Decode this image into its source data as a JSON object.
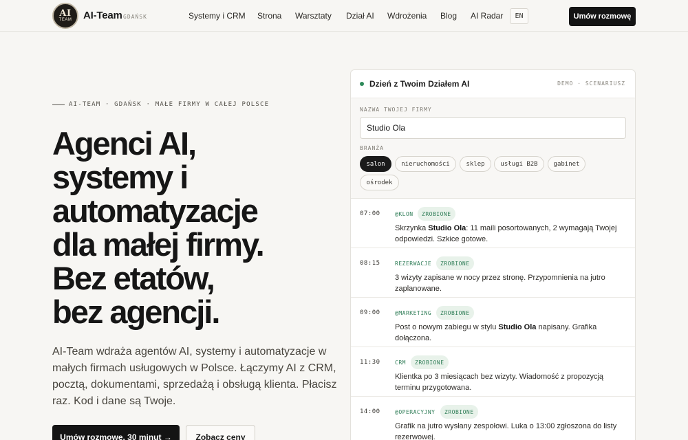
{
  "header": {
    "logo_line1": "AI",
    "logo_line2": "TEAM",
    "brand": "AI-Team",
    "brand_sub": "GDAŃSK",
    "nav": [
      {
        "label": "Systemy i CRM"
      },
      {
        "label": "Strona"
      },
      {
        "label": "Warsztaty"
      },
      {
        "label": "Dział AI"
      },
      {
        "label": "Wdrożenia"
      },
      {
        "label": "Blog"
      },
      {
        "label": "AI Radar"
      }
    ],
    "lang": "EN",
    "cta": "Umów rozmowę"
  },
  "hero": {
    "eyebrow": "AI-TEAM · GDAŃSK · MAŁE FIRMY W CAŁEJ POLSCE",
    "headline": [
      "Agenci AI,",
      "systemy i",
      "automatyzacje",
      "dla małej firmy.",
      "Bez etatów,",
      "bez agencji."
    ],
    "lead": "AI-Team wdraża agentów AI, systemy i automatyzacje w małych firmach usługowych w Polsce. Łączymy AI z CRM, pocztą, dokumentami, sprzedażą i obsługą klienta. Płacisz raz. Kod i dane są Twoje.",
    "primary_button": "Umów rozmowę, 30 minut →",
    "secondary_button": "Zobacz ceny"
  },
  "demo": {
    "title": "Dzień z Twoim Działem AI",
    "meta": "DEMO · SCENARIUSZ",
    "company_label": "NAZWA TWOJEJ FIRMY",
    "company_value": "Studio Ola",
    "industry_label": "BRANŻA",
    "industries": [
      {
        "label": "salon",
        "active": true
      },
      {
        "label": "nieruchomości",
        "active": false
      },
      {
        "label": "sklep",
        "active": false
      },
      {
        "label": "usługi B2B",
        "active": false
      },
      {
        "label": "gabinet",
        "active": false
      },
      {
        "label": "ośrodek",
        "active": false
      }
    ],
    "status_label": "ZROBIONE",
    "entries": [
      {
        "time": "07:00",
        "agent": "@KLON",
        "status": "ZROBIONE",
        "text_before": "Skrzynka ",
        "text_bold": "Studio Ola",
        "text_after": ": 11 maili posortowanych, 2 wymagają Twojej odpowiedzi. Szkice gotowe."
      },
      {
        "time": "08:15",
        "agent": "REZERWACJE",
        "status": "ZROBIONE",
        "text_before": "3 wizyty zapisane w nocy przez stronę. Przypomnienia na jutro zaplanowane.",
        "text_bold": "",
        "text_after": ""
      },
      {
        "time": "09:00",
        "agent": "@MARKETING",
        "status": "ZROBIONE",
        "text_before": "Post o nowym zabiegu w stylu ",
        "text_bold": "Studio Ola",
        "text_after": " napisany. Grafika dołączona."
      },
      {
        "time": "11:30",
        "agent": "CRM",
        "status": "ZROBIONE",
        "text_before": "Klientka po 3 miesiącach bez wizyty. Wiadomość z propozycją terminu przygotowana.",
        "text_bold": "",
        "text_after": ""
      },
      {
        "time": "14:00",
        "agent": "@OPERACYJNY",
        "status": "ZROBIONE",
        "text_before": "Grafik na jutro wysłany zespołowi. Luka o 13:00 zgłoszona do listy rezerwowej.",
        "text_bold": "",
        "text_after": ""
      }
    ]
  }
}
